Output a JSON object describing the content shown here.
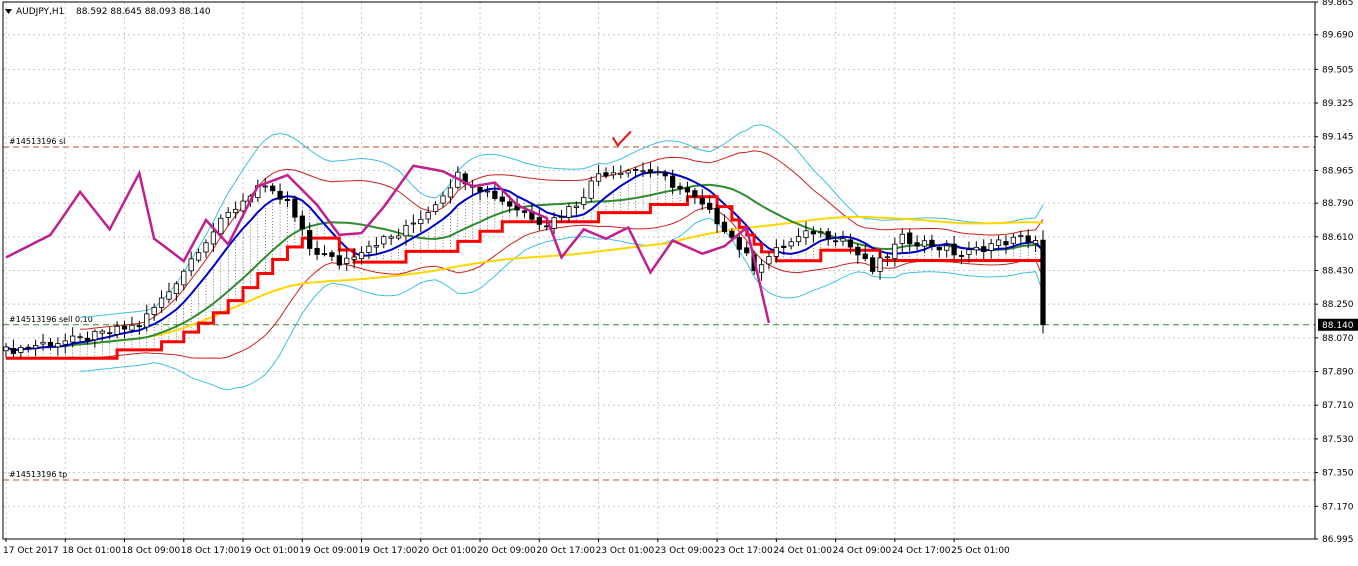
{
  "header": {
    "symbol_label": "AUDJPY,H1",
    "ohlc_text": "88.592 88.645 88.093 88.140"
  },
  "order_lines": [
    {
      "label": "#14513196 sl",
      "price": 89.09,
      "color": "#c0502a"
    },
    {
      "label": "#14513196 sell 0.10",
      "price": 88.14,
      "color": "#2e8b2e"
    },
    {
      "label": "#14513196 tp",
      "price": 87.31,
      "color": "#c0502a"
    }
  ],
  "current_price_label": "88.140",
  "colors": {
    "bull_candle": "#ffffff",
    "bear_candle": "#000000",
    "fast_ma": "#0000cc",
    "mid_ma": "#2e8b2e",
    "stop_line": "#ff0000",
    "slow_ma": "#ffd700",
    "oscillator": "#c0208f",
    "outer_band": "#40c0e0",
    "inner_band": "#cc2020",
    "checkmark": "#e81010"
  },
  "chart_data": {
    "type": "candlestick",
    "price_axis": {
      "ylim": [
        86.995,
        89.865
      ],
      "ticks": [
        "89.865",
        "89.690",
        "89.505",
        "89.325",
        "89.145",
        "88.965",
        "88.790",
        "88.610",
        "88.430",
        "88.250",
        "88.070",
        "87.890",
        "87.710",
        "87.530",
        "87.350",
        "87.170",
        "86.995"
      ]
    },
    "time_axis": {
      "ticks": [
        "17 Oct 2017",
        "18 Oct 01:00",
        "18 Oct 09:00",
        "18 Oct 17:00",
        "19 Oct 01:00",
        "19 Oct 09:00",
        "19 Oct 17:00",
        "20 Oct 01:00",
        "20 Oct 09:00",
        "20 Oct 17:00",
        "23 Oct 01:00",
        "23 Oct 09:00",
        "23 Oct 17:00",
        "24 Oct 01:00",
        "24 Oct 09:00",
        "24 Oct 17:00",
        "25 Oct 01:00"
      ]
    },
    "last_bar": {
      "open": 88.592,
      "high": 88.645,
      "low": 88.093,
      "close": 88.14
    },
    "close_anchors": [
      [
        0,
        88.0
      ],
      [
        5,
        88.04
      ],
      [
        10,
        88.06
      ],
      [
        14,
        88.1
      ],
      [
        18,
        88.14
      ],
      [
        22,
        88.32
      ],
      [
        26,
        88.55
      ],
      [
        30,
        88.73
      ],
      [
        34,
        88.88
      ],
      [
        38,
        88.79
      ],
      [
        41,
        88.55
      ],
      [
        45,
        88.47
      ],
      [
        49,
        88.57
      ],
      [
        53,
        88.62
      ],
      [
        57,
        88.75
      ],
      [
        61,
        88.94
      ],
      [
        65,
        88.85
      ],
      [
        69,
        88.76
      ],
      [
        73,
        88.68
      ],
      [
        77,
        88.79
      ],
      [
        80,
        88.95
      ],
      [
        83,
        88.97
      ],
      [
        86,
        88.97
      ],
      [
        89,
        88.92
      ],
      [
        93,
        88.81
      ],
      [
        97,
        88.66
      ],
      [
        101,
        88.45
      ],
      [
        105,
        88.56
      ],
      [
        109,
        88.64
      ],
      [
        113,
        88.6
      ],
      [
        117,
        88.43
      ],
      [
        121,
        88.6
      ],
      [
        125,
        88.57
      ],
      [
        129,
        88.51
      ],
      [
        133,
        88.57
      ],
      [
        137,
        88.6
      ],
      [
        140,
        88.59
      ]
    ],
    "oscillator_anchors": [
      [
        0,
        88.5
      ],
      [
        6,
        88.62
      ],
      [
        10,
        88.85
      ],
      [
        14,
        88.65
      ],
      [
        18,
        88.95
      ],
      [
        20,
        88.6
      ],
      [
        24,
        88.48
      ],
      [
        27,
        88.7
      ],
      [
        30,
        88.57
      ],
      [
        34,
        88.88
      ],
      [
        38,
        88.94
      ],
      [
        42,
        88.78
      ],
      [
        45,
        88.62
      ],
      [
        48,
        88.63
      ],
      [
        51,
        88.77
      ],
      [
        55,
        88.99
      ],
      [
        59,
        88.96
      ],
      [
        63,
        88.88
      ],
      [
        66,
        88.9
      ],
      [
        69,
        88.78
      ],
      [
        73,
        88.71
      ],
      [
        75,
        88.5
      ],
      [
        78,
        88.65
      ],
      [
        81,
        88.6
      ],
      [
        84,
        88.66
      ],
      [
        87,
        88.42
      ],
      [
        90,
        88.59
      ],
      [
        94,
        88.52
      ],
      [
        97,
        88.56
      ],
      [
        100,
        88.66
      ],
      [
        103,
        88.15
      ]
    ],
    "series": [
      {
        "name": "",
        "type": "ma-fast"
      },
      {
        "name": "",
        "type": "ma-mid"
      },
      {
        "name": "",
        "type": "stop-line"
      },
      {
        "name": "",
        "type": "ma-slow"
      },
      {
        "name": "",
        "type": "oscillator"
      },
      {
        "name": "",
        "type": "bands"
      }
    ],
    "grid": true
  }
}
